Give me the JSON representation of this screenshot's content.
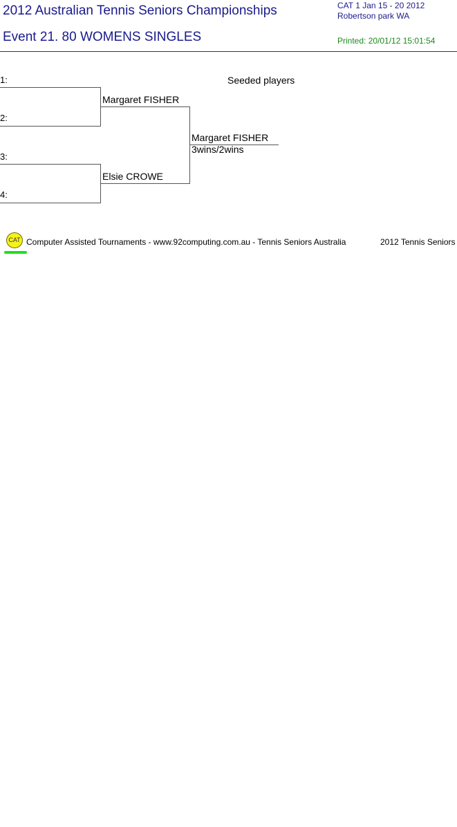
{
  "header": {
    "title": "2012 Australian Tennis Seniors Championships",
    "event": "Event 21. 80 WOMENS SINGLES",
    "cat_line": "CAT 1   Jan 15 - 20 2012",
    "venue_line": "Robertson park   WA",
    "printed": "Printed: 20/01/12 15:01:54"
  },
  "bracket": {
    "seeded_label": "Seeded players",
    "slots": [
      "1:",
      "2:",
      "3:",
      "4:"
    ],
    "round2": [
      "Margaret FISHER",
      "Elsie CROWE"
    ],
    "final": {
      "winner": "Margaret FISHER",
      "score": "3wins/2wins"
    }
  },
  "footer": {
    "logo_text": "CAT",
    "text": "Computer Assisted Tournaments - www.92computing.com.au -  Tennis Seniors Australia",
    "right_text": "2012 Tennis Seniors"
  },
  "colors": {
    "header_blue": "#1a1a8c",
    "printed_green": "#1b8a1b",
    "logo_yellow": "#f6f21a",
    "logo_underline": "#22dd22"
  }
}
